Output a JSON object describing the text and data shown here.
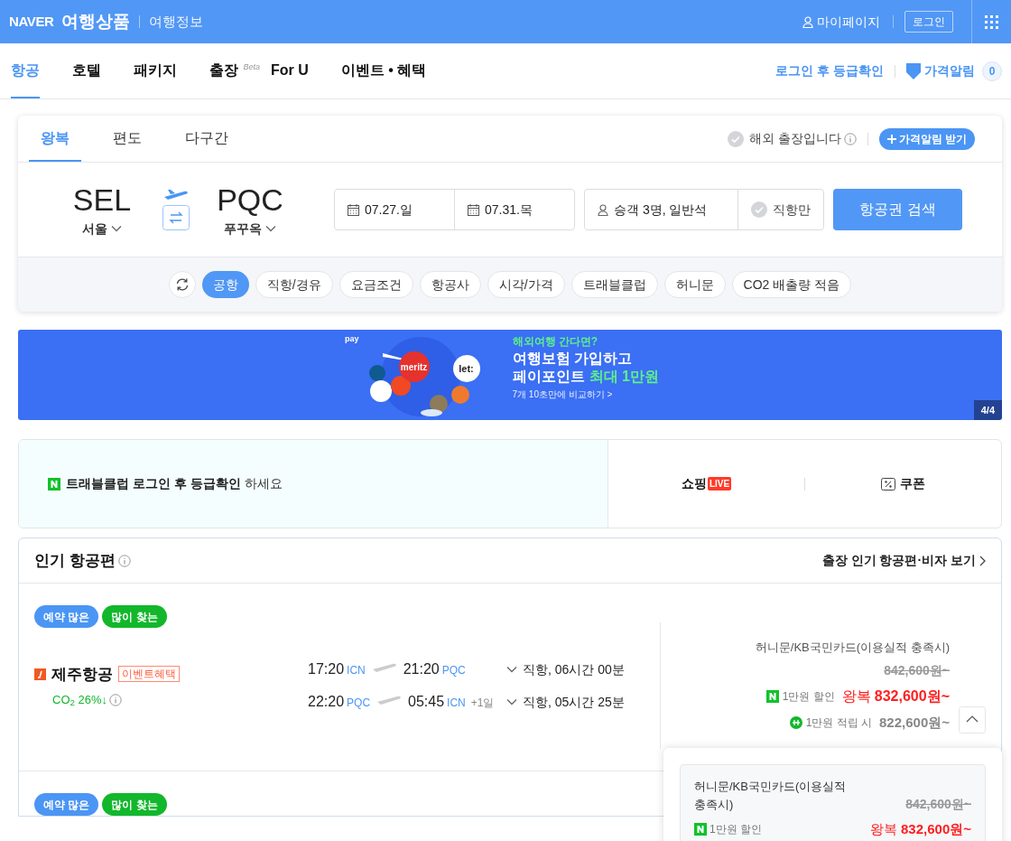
{
  "header": {
    "logo": "NAVER",
    "service": "여행상품",
    "link": "여행정보",
    "mypage": "마이페이지",
    "login": "로그인"
  },
  "nav": {
    "tabs": [
      {
        "label": "항공",
        "selected": true
      },
      {
        "label": "호텔",
        "selected": false
      },
      {
        "label": "패키지",
        "selected": false
      },
      {
        "label": "출장",
        "badge": "Beta",
        "selected": false
      },
      {
        "label": "For U",
        "selected": false
      },
      {
        "label": "이벤트 • 혜택",
        "selected": false
      }
    ],
    "grade": "로그인 후 등급확인",
    "price_alert": "가격알림",
    "alert_count": "0"
  },
  "search": {
    "trip_tabs": [
      {
        "label": "왕복",
        "selected": true
      },
      {
        "label": "편도",
        "selected": false
      },
      {
        "label": "다구간",
        "selected": false
      }
    ],
    "business": {
      "label": "해외 출장입니다",
      "checked": false
    },
    "alert_button": "가격알림 받기",
    "origin": {
      "code": "SEL",
      "city": "서울"
    },
    "destination": {
      "code": "PQC",
      "city": "푸꾸옥"
    },
    "depart": "07.27.일",
    "return": "07.31.목",
    "passengers": "승객 3명, 일반석",
    "direct": {
      "label": "직항만",
      "checked": false
    },
    "search_button": "항공권 검색",
    "filters": [
      {
        "label": "공항",
        "selected": true
      },
      {
        "label": "직항/경유",
        "selected": false
      },
      {
        "label": "요금조건",
        "selected": false
      },
      {
        "label": "항공사",
        "selected": false
      },
      {
        "label": "시각/가격",
        "selected": false
      },
      {
        "label": "트래블클럽",
        "selected": false
      },
      {
        "label": "허니문",
        "selected": false
      },
      {
        "label": "CO2 배출량 적음",
        "selected": false
      }
    ]
  },
  "banner": {
    "pay": "pay",
    "logos": [
      "meritz",
      "let:"
    ],
    "kicker": "해외여행 간다면?",
    "line1": "여행보험 가입하고",
    "line2": "페이포인트",
    "highlight": "최대 1만원",
    "cta": "7개 10초만에 비교하기 >",
    "counter": "4/4"
  },
  "club": {
    "text": "트래블클럽 로그인 후 등급확인",
    "suffix": "하세요",
    "shopping": "쇼핑",
    "live": "LIVE",
    "coupon": "쿠폰"
  },
  "popular": {
    "title": "인기 항공편",
    "link": "출장 인기 항공편·비자 보기",
    "flights": [
      {
        "tags": [
          {
            "label": "예약 많은",
            "color": "#4b95f4"
          },
          {
            "label": "많이 찾는",
            "color": "#12b72b"
          }
        ],
        "airline": "제주항공",
        "badge": "이벤트혜택",
        "co2": "CO$_{2}$ 26%↓",
        "legs": [
          {
            "dep": "17:20",
            "from": "ICN",
            "arr": "21:20",
            "to": "PQC",
            "info": "직항, 06시간 00분"
          },
          {
            "dep": "22:20",
            "from": "PQC",
            "arr": "05:45",
            "to": "ICN",
            "next_day": "+1일",
            "info": "직항, 05시간 25분"
          }
        ],
        "price": {
          "card": "허니문/KB국민카드(이용실적 충족시)",
          "original": "842,600원~",
          "discount": "1만원 할인",
          "trip": "왕복",
          "amount": "832,600원~",
          "points": "1만원 적립 시",
          "points_amount": "822,600원~"
        }
      },
      {
        "tags": [
          {
            "label": "예약 많은",
            "color": "#4b95f4"
          },
          {
            "label": "많이 찾는",
            "color": "#12b72b"
          }
        ]
      }
    ]
  },
  "popup": {
    "card": "허니문/KB국민카드(이용실적 충족시)",
    "original": "842,600원~",
    "discount": "1만원 할인",
    "trip": "왕복",
    "amount": "832,600원~"
  }
}
